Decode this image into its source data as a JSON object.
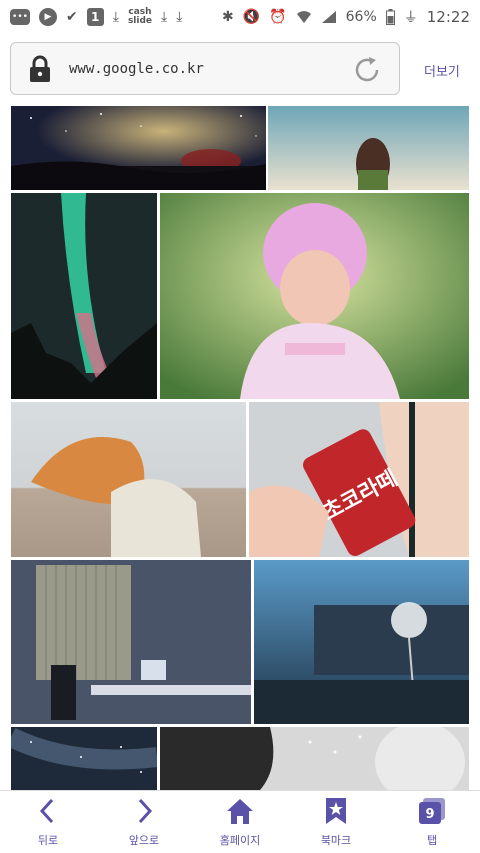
{
  "status_bar": {
    "cash_label_1": "cash",
    "cash_label_2": "slide",
    "battery_percent": "66%",
    "time": "12:22"
  },
  "address_bar": {
    "url": "www.google.co.kr",
    "more_label": "더보기"
  },
  "image_results": [
    {
      "name": "image-starry-sky"
    },
    {
      "name": "image-girl-sky"
    },
    {
      "name": "image-aurora"
    },
    {
      "name": "image-pink-hair-girl"
    },
    {
      "name": "image-red-hair-beach"
    },
    {
      "name": "image-can-drink"
    },
    {
      "name": "image-dark-room"
    },
    {
      "name": "image-dandelion"
    },
    {
      "name": "image-night-sky"
    },
    {
      "name": "image-face-closeup"
    }
  ],
  "can_text": "초코라떼",
  "bottom_nav": {
    "back_label": "뒤로",
    "forward_label": "앞으로",
    "home_label": "홈페이지",
    "bookmark_label": "북마크",
    "tabs_label": "탭",
    "tab_count": "9"
  },
  "colors": {
    "accent": "#5a52a8"
  }
}
